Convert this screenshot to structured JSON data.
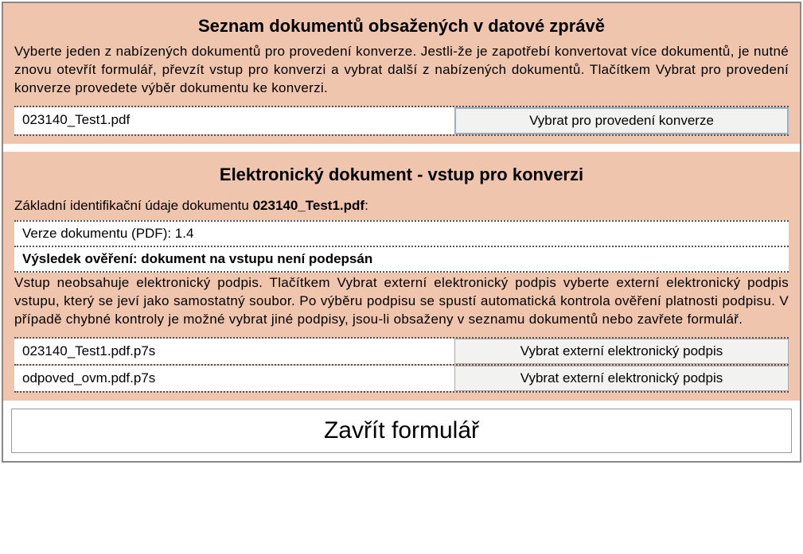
{
  "section1": {
    "title": "Seznam dokumentů obsažených v datové zprávě",
    "description": "Vyberte jeden z nabízených dokumentů pro provedení konverze. Jestli-že je zapotřebí konvertovat více dokumentů, je nutné znovu otevřít formulář, převzít vstup pro konverzi a vybrat další z nabízených dokumentů. Tlačítkem Vybrat pro provedení konverze provedete výběr dokumentu ke konverzi.",
    "row": {
      "filename": "023140_Test1.pdf",
      "button": "Vybrat pro provedení konverze"
    }
  },
  "section2": {
    "title": "Elektronický dokument - vstup pro konverzi",
    "subheader_prefix": "Základní identifikační údaje dokumentu ",
    "subheader_doc": "023140_Test1.pdf",
    "subheader_suffix": ":",
    "version_line": "Verze dokumentu (PDF): 1.4",
    "result_line": "Výsledek ověření: dokument na vstupu není podepsán",
    "description": "Vstup neobsahuje elektronický podpis. Tlačítkem Vybrat externí elektronický podpis vyberte externí elektronický podpis vstupu, který se jeví jako samostatný soubor. Po výběru podpisu se spustí automatická kontrola ověření platnosti podpisu. V případě chybné kontroly je možné vybrat jiné podpisy, jsou-li obsaženy v seznamu dokumentů nebo zavřete formulář.",
    "rows": [
      {
        "filename": "023140_Test1.pdf.p7s",
        "button": "Vybrat externí elektronický podpis"
      },
      {
        "filename": "odpoved_ovm.pdf.p7s",
        "button": "Vybrat externí elektronický podpis"
      }
    ]
  },
  "close_label": "Zavřít formulář"
}
